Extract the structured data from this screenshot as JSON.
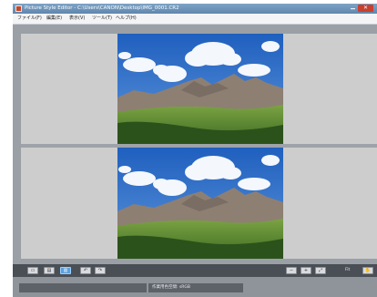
{
  "window": {
    "title": "Picture Style Editor - C:\\Users\\CANON\\Desktop\\IMG_0001.CR2",
    "close_glyph": "✕"
  },
  "menu": [
    {
      "label": "ファイル(F)"
    },
    {
      "label": "編集(E)"
    },
    {
      "label": "表示(V)"
    },
    {
      "label": "ツール(T)"
    },
    {
      "label": "ヘルプ(H)"
    }
  ],
  "toolbar": {
    "zoom_label": "Fit",
    "icons": [
      "single-view-icon",
      "split-view-icon",
      "compare-view-icon",
      "rotate-left-icon",
      "rotate-right-icon",
      "zoom-out-icon",
      "zoom-in-icon",
      "zoom-fit-icon",
      "hand-tool-icon"
    ]
  },
  "status": {
    "text": "作業用色空間: sRGB"
  },
  "colors": {
    "sky": "#2f6fc4",
    "cloud": "#ffffff",
    "rock": "#8e7f73",
    "forest": "#2f5a1e",
    "meadow": "#6f9a3a",
    "pane_bg": "#cdcdcd",
    "workspace_bg": "#9aa0a6"
  }
}
